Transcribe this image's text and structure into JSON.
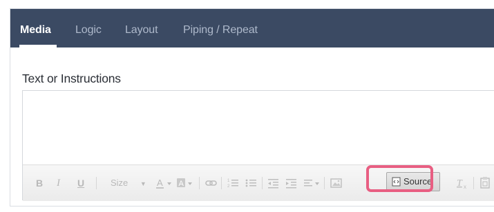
{
  "tabs": [
    {
      "label": "Media",
      "active": true
    },
    {
      "label": "Logic",
      "active": false
    },
    {
      "label": "Layout",
      "active": false
    },
    {
      "label": "Piping / Repeat",
      "active": false
    }
  ],
  "section": {
    "label": "Text or Instructions"
  },
  "toolbar": {
    "bold_label": "B",
    "italic_label": "I",
    "underline_label": "U",
    "size_label": "Size",
    "source_label": "Source"
  },
  "colors": {
    "tab_bar": "#3b4a63",
    "highlight": "#e85e82"
  }
}
